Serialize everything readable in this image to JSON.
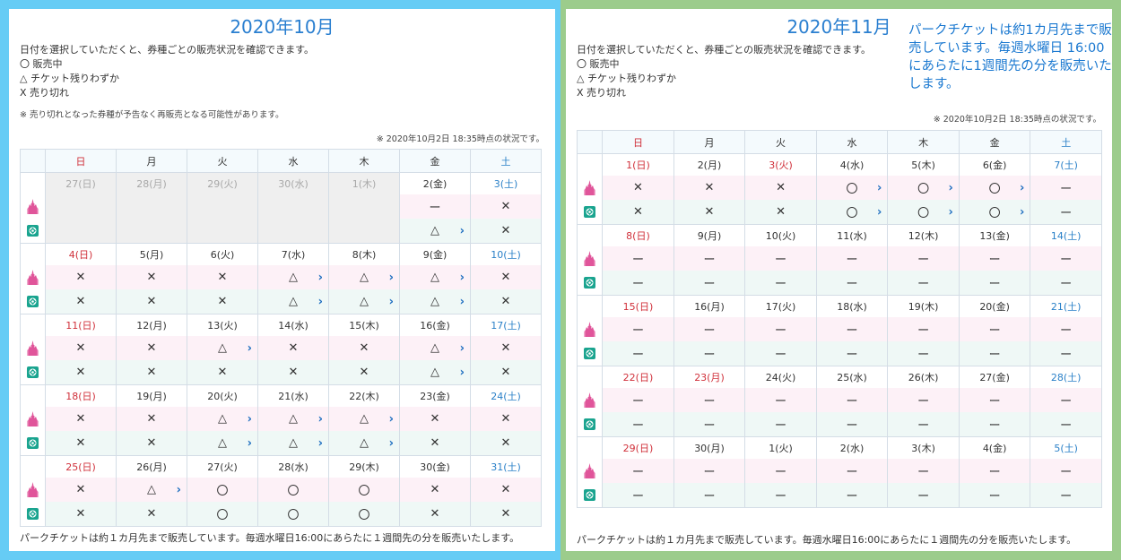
{
  "october": {
    "title": "2020年10月",
    "intro": [
      "日付を選択していただくと、券種ごとの販売状況を確認できます。",
      "〇 販売中",
      "△ チケット残りわずか",
      "X 売り切れ"
    ],
    "note": "※ 売り切れとなった券種が予告なく再販売となる可能性があります。",
    "asof": "※ 2020年10月2日 18:35時点の状況です。",
    "weekdays": [
      "日",
      "月",
      "火",
      "水",
      "木",
      "金",
      "土"
    ],
    "weeks": [
      [
        {
          "d": "27(日)",
          "past": true
        },
        {
          "d": "28(月)",
          "past": true
        },
        {
          "d": "29(火)",
          "past": true
        },
        {
          "d": "30(水)",
          "past": true
        },
        {
          "d": "1(木)",
          "past": true
        },
        {
          "d": "2(金)",
          "l": "ー",
          "s": "△",
          "sa": true
        },
        {
          "d": "3(土)",
          "l": "✕",
          "s": "✕"
        }
      ],
      [
        {
          "d": "4(日)",
          "l": "✕",
          "s": "✕"
        },
        {
          "d": "5(月)",
          "l": "✕",
          "s": "✕"
        },
        {
          "d": "6(火)",
          "l": "✕",
          "s": "✕"
        },
        {
          "d": "7(水)",
          "l": "△",
          "la": true,
          "s": "△",
          "sa": true
        },
        {
          "d": "8(木)",
          "l": "△",
          "la": true,
          "s": "△",
          "sa": true
        },
        {
          "d": "9(金)",
          "l": "△",
          "la": true,
          "s": "△",
          "sa": true
        },
        {
          "d": "10(土)",
          "l": "✕",
          "s": "✕"
        }
      ],
      [
        {
          "d": "11(日)",
          "l": "✕",
          "s": "✕"
        },
        {
          "d": "12(月)",
          "l": "✕",
          "s": "✕"
        },
        {
          "d": "13(火)",
          "l": "△",
          "la": true,
          "s": "✕"
        },
        {
          "d": "14(水)",
          "l": "✕",
          "s": "✕"
        },
        {
          "d": "15(木)",
          "l": "✕",
          "s": "✕"
        },
        {
          "d": "16(金)",
          "l": "△",
          "la": true,
          "s": "△",
          "sa": true
        },
        {
          "d": "17(土)",
          "l": "✕",
          "s": "✕"
        }
      ],
      [
        {
          "d": "18(日)",
          "l": "✕",
          "s": "✕"
        },
        {
          "d": "19(月)",
          "l": "✕",
          "s": "✕"
        },
        {
          "d": "20(火)",
          "l": "△",
          "la": true,
          "s": "△",
          "sa": true
        },
        {
          "d": "21(水)",
          "l": "△",
          "la": true,
          "s": "△",
          "sa": true
        },
        {
          "d": "22(木)",
          "l": "△",
          "la": true,
          "s": "△",
          "sa": true
        },
        {
          "d": "23(金)",
          "l": "✕",
          "s": "✕"
        },
        {
          "d": "24(土)",
          "l": "✕",
          "s": "✕"
        }
      ],
      [
        {
          "d": "25(日)",
          "l": "✕",
          "s": "✕"
        },
        {
          "d": "26(月)",
          "l": "△",
          "la": true,
          "s": "✕"
        },
        {
          "d": "27(火)",
          "l": "〇",
          "s": "〇"
        },
        {
          "d": "28(水)",
          "l": "〇",
          "s": "〇"
        },
        {
          "d": "29(木)",
          "l": "〇",
          "s": "〇"
        },
        {
          "d": "30(金)",
          "l": "✕",
          "s": "✕"
        },
        {
          "d": "31(土)",
          "l": "✕",
          "s": "✕"
        }
      ]
    ],
    "footer": "パークチケットは約１カ月先まで販売しています。毎週水曜日16:00にあらたに１週間先の分を販売いたします。"
  },
  "november": {
    "title": "2020年11月",
    "callout": "パークチケットは約1カ月先まで販売しています。毎週水曜日 16:00にあらたに1週間先の分を販売いたします。",
    "intro": [
      "日付を選択していただくと、券種ごとの販売状況を確認できます。",
      "〇 販売中",
      "△ チケット残りわずか",
      "X 売り切れ"
    ],
    "asof": "※ 2020年10月2日 18:35時点の状況です。",
    "weekdays": [
      "日",
      "月",
      "火",
      "水",
      "木",
      "金",
      "土"
    ],
    "weeks": [
      [
        {
          "d": "1(日)",
          "l": "✕",
          "s": "✕"
        },
        {
          "d": "2(月)",
          "l": "✕",
          "s": "✕"
        },
        {
          "d": "3(火)",
          "hol": true,
          "l": "✕",
          "s": "✕"
        },
        {
          "d": "4(水)",
          "l": "〇",
          "la": true,
          "s": "〇",
          "sa": true
        },
        {
          "d": "5(木)",
          "l": "〇",
          "la": true,
          "s": "〇",
          "sa": true
        },
        {
          "d": "6(金)",
          "l": "〇",
          "la": true,
          "s": "〇",
          "sa": true
        },
        {
          "d": "7(土)",
          "l": "ー",
          "s": "ー"
        }
      ],
      [
        {
          "d": "8(日)",
          "l": "ー",
          "s": "ー"
        },
        {
          "d": "9(月)",
          "l": "ー",
          "s": "ー"
        },
        {
          "d": "10(火)",
          "l": "ー",
          "s": "ー"
        },
        {
          "d": "11(水)",
          "l": "ー",
          "s": "ー"
        },
        {
          "d": "12(木)",
          "l": "ー",
          "s": "ー"
        },
        {
          "d": "13(金)",
          "l": "ー",
          "s": "ー"
        },
        {
          "d": "14(土)",
          "l": "ー",
          "s": "ー"
        }
      ],
      [
        {
          "d": "15(日)",
          "l": "ー",
          "s": "ー"
        },
        {
          "d": "16(月)",
          "l": "ー",
          "s": "ー"
        },
        {
          "d": "17(火)",
          "l": "ー",
          "s": "ー"
        },
        {
          "d": "18(水)",
          "l": "ー",
          "s": "ー"
        },
        {
          "d": "19(木)",
          "l": "ー",
          "s": "ー"
        },
        {
          "d": "20(金)",
          "l": "ー",
          "s": "ー"
        },
        {
          "d": "21(土)",
          "l": "ー",
          "s": "ー"
        }
      ],
      [
        {
          "d": "22(日)",
          "l": "ー",
          "s": "ー"
        },
        {
          "d": "23(月)",
          "hol": true,
          "l": "ー",
          "s": "ー"
        },
        {
          "d": "24(火)",
          "l": "ー",
          "s": "ー"
        },
        {
          "d": "25(水)",
          "l": "ー",
          "s": "ー"
        },
        {
          "d": "26(木)",
          "l": "ー",
          "s": "ー"
        },
        {
          "d": "27(金)",
          "l": "ー",
          "s": "ー"
        },
        {
          "d": "28(土)",
          "l": "ー",
          "s": "ー"
        }
      ],
      [
        {
          "d": "29(日)",
          "l": "ー",
          "s": "ー"
        },
        {
          "d": "30(月)",
          "l": "ー",
          "s": "ー"
        },
        {
          "d": "1(火)",
          "l": "ー",
          "s": "ー"
        },
        {
          "d": "2(水)",
          "l": "ー",
          "s": "ー"
        },
        {
          "d": "3(木)",
          "l": "ー",
          "s": "ー"
        },
        {
          "d": "4(金)",
          "l": "ー",
          "s": "ー"
        },
        {
          "d": "5(土)",
          "l": "ー",
          "s": "ー"
        }
      ]
    ],
    "footer": "パークチケットは約１カ月先まで販売しています。毎週水曜日16:00にあらたに１週間先の分を販売いたします。"
  },
  "colors": {
    "oct_border": "#66ccf5",
    "nov_border": "#9ccc8c",
    "title": "#2a7fd0",
    "sunday": "#d0303a",
    "saturday": "#2a80c8",
    "land_row": "#fdf1f7",
    "sea_row": "#eff8f6"
  },
  "icons": {
    "land": "castle-icon",
    "sea": "globe-icon"
  }
}
